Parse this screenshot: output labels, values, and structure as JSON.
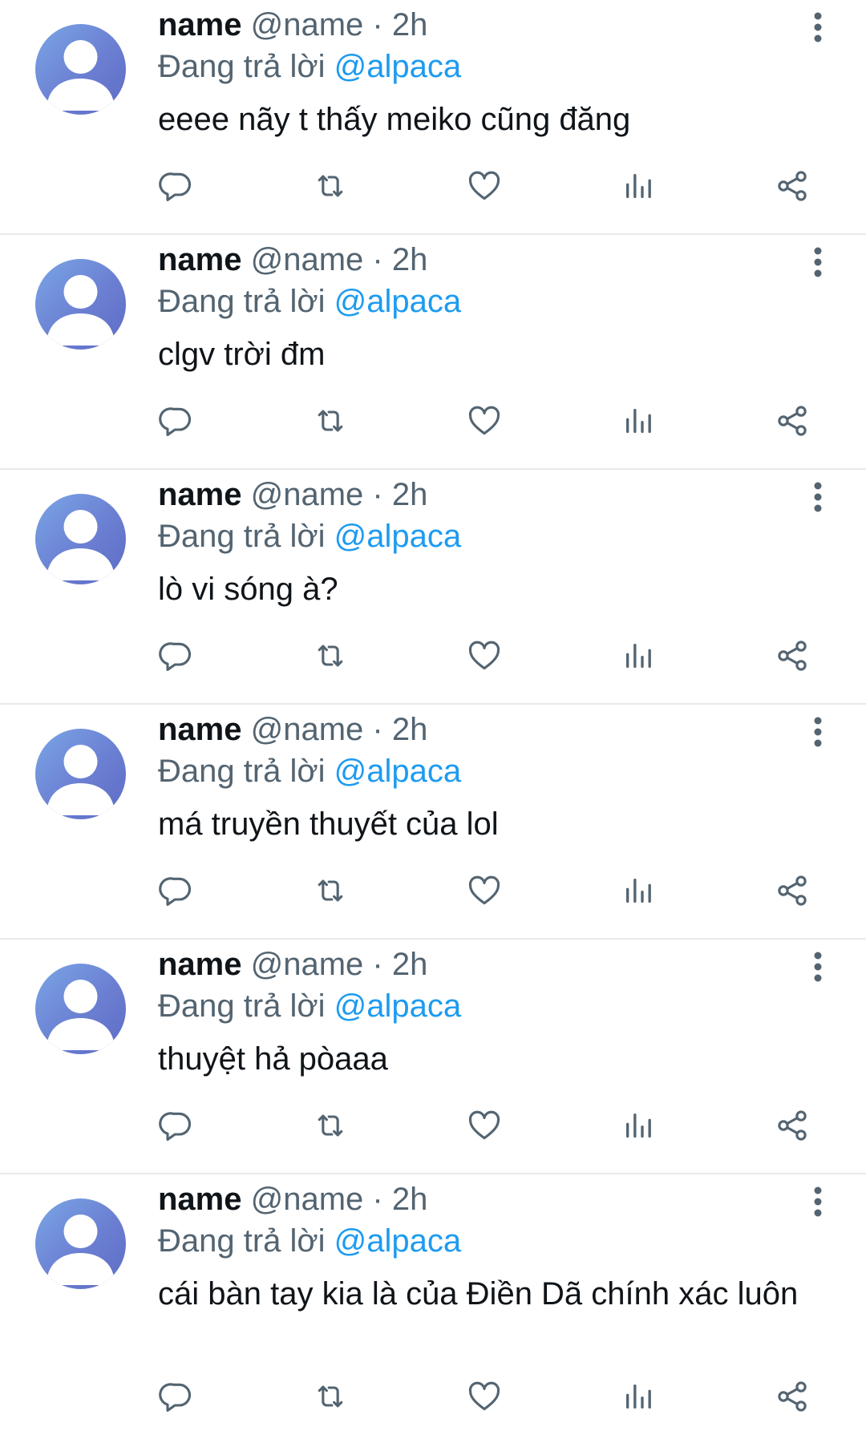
{
  "replying_prefix": "Đang trả lời",
  "icons": {
    "reply": "reply-icon",
    "retweet": "retweet-icon",
    "like": "heart-icon",
    "views": "views-bar-chart-icon",
    "share": "share-icon",
    "more": "more-vertical-icon",
    "avatar": "default-avatar-icon"
  },
  "colors": {
    "accent": "#1d9bf0",
    "secondary_text": "#536471",
    "icon": "#536471",
    "avatar": "#6b7fd2",
    "divider": "#e7e9ec"
  },
  "tweets": [
    {
      "name": "name",
      "handle": "@name",
      "dot": "·",
      "time": "2h",
      "mention": "@alpaca",
      "text": "eeee nãy t thấy meiko cũng đăng"
    },
    {
      "name": "name",
      "handle": "@name",
      "dot": "·",
      "time": "2h",
      "mention": "@alpaca",
      "text": "clgv trời đm"
    },
    {
      "name": "name",
      "handle": "@name",
      "dot": "·",
      "time": "2h",
      "mention": "@alpaca",
      "text": "lò vi sóng à?"
    },
    {
      "name": "name",
      "handle": "@name",
      "dot": "·",
      "time": "2h",
      "mention": "@alpaca",
      "text": "má truyền thuyết của lol"
    },
    {
      "name": "name",
      "handle": "@name",
      "dot": "·",
      "time": "2h",
      "mention": "@alpaca",
      "text": "thuyệt hả pòaaa"
    },
    {
      "name": "name",
      "handle": "@name",
      "dot": "·",
      "time": "2h",
      "mention": "@alpaca",
      "text": "cái bàn tay kia là của Điền Dã chính xác luôn"
    }
  ]
}
